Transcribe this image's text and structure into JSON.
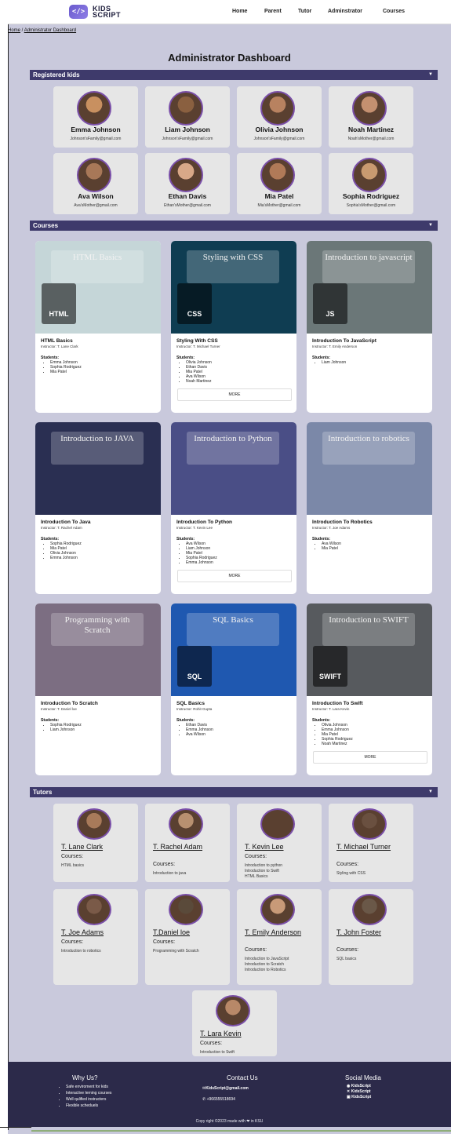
{
  "brand": {
    "line1": "KIDS",
    "line2": "SCRIPT",
    "mark": "</>"
  },
  "nav": [
    "Home",
    "Parent",
    "Tutor",
    "Adminstrator",
    "Courses"
  ],
  "breadcrumb": {
    "home": "Home",
    "sep": " / ",
    "current": "Administrator Dashboard"
  },
  "title": "Administrator Dashboard",
  "sections": {
    "kids": "Registered kids",
    "courses": "Courses",
    "tutors": "Tutors"
  },
  "kids": [
    {
      "name": "Emma Johnson",
      "email": "Johnson'sFamily@gmail.com",
      "avatar_color": "#c89060"
    },
    {
      "name": "Liam Johnson",
      "email": "Johnson'sFamily@gmail.com",
      "avatar_color": "#8a6040"
    },
    {
      "name": "Olivia Johnson",
      "email": "Johnson'sFamily@gmail.com",
      "avatar_color": "#b88260"
    },
    {
      "name": "Noah Martinez",
      "email": "Noah'sMother@gmail.com",
      "avatar_color": "#c49070"
    },
    {
      "name": "Ava Wilson",
      "email": "Ava'sMother@gmail.com",
      "avatar_color": "#a87858"
    },
    {
      "name": "Ethan Davis",
      "email": "Ethan'sMother@gmail.com",
      "avatar_color": "#d8a888"
    },
    {
      "name": "Mia Patel",
      "email": "Mia'sMother@gmail.com",
      "avatar_color": "#b07a58"
    },
    {
      "name": "Sophia Rodriguez",
      "email": "Sophia'sMother@gmail.com",
      "avatar_color": "#c89a70"
    }
  ],
  "students_label": "Students:",
  "more_label": "MORE",
  "courses": [
    {
      "title": "HTML Basics",
      "instructor": "Instructor: T. Lane Clark",
      "img_title": "HTML Basics",
      "badge": "HTML",
      "bg": "#c5d6d8",
      "students": [
        "Emma Johnson",
        "Sophia Rodriguez",
        "Mia Patel"
      ],
      "more": false
    },
    {
      "title": "Styling With CSS",
      "instructor": "Instructor: T. Michael Turner",
      "img_title": "Styling with CSS",
      "badge": "CSS",
      "bg": "#0f3d52",
      "students": [
        "Olivia Johnson",
        "Ethan Davis",
        "Mia Patel",
        "Ava Wilson",
        "Noah Martinez"
      ],
      "more": true
    },
    {
      "title": "Introduction To JavaScript",
      "instructor": "Instructor: T. Emily Anderson",
      "img_title": "Introduction to javascript",
      "badge": "JS",
      "bg": "#6b7778",
      "students": [
        "Liam Johnson"
      ],
      "more": false
    },
    {
      "title": "Introduction To Java",
      "instructor": "Instructor: T. Rachel Adam",
      "img_title": "Introduction to JAVA",
      "badge": "",
      "bg": "#2a2f52",
      "students": [
        "Sophia Rodriguez",
        "Mia Patel",
        "Olivia Johnson",
        "Emma Johnson"
      ],
      "more": false
    },
    {
      "title": "Introduction To Python",
      "instructor": "Instructor: T. Kevin Lee",
      "img_title": "Introduction to Python",
      "badge": "",
      "bg": "#4a4e86",
      "students": [
        "Ava Wilson",
        "Liam Johnson",
        "Mia Patel",
        "Sophia Rodriguez",
        "Emma Johnson"
      ],
      "more": true
    },
    {
      "title": "Introduction To Robotics",
      "instructor": "Instructor: T. Joe Adams",
      "img_title": "Introduction to robotics",
      "badge": "",
      "bg": "#7b88a8",
      "students": [
        "Ava Wilson",
        "Mia Patel"
      ],
      "more": false
    },
    {
      "title": "Introduction To Scratch",
      "instructor": "Instructor: T. Daniel loe",
      "img_title": "Programming with Scratch",
      "badge": "",
      "bg": "#7c6e82",
      "students": [
        "Sophia Rodriguez",
        "Liam Johnson"
      ],
      "more": false
    },
    {
      "title": "SQL Basics",
      "instructor": "Instructor: Rohit Gupta",
      "img_title": "SQL Basics",
      "badge": "SQL",
      "bg": "#1f58b0",
      "students": [
        "Ethan Davis",
        "Emma Johnson",
        "Ava Wilson"
      ],
      "more": false
    },
    {
      "title": "Introduction To Swift",
      "instructor": "Instructor: T. Lara Kevin",
      "img_title": "Introduction to SWIFT",
      "badge": "SWIFT",
      "bg": "#575a5e",
      "students": [
        "Olivia Johnson",
        "Emma Johnson",
        "Mia Patel",
        "Sophia Rodriguez",
        "Noah Martinez"
      ],
      "more": true
    }
  ],
  "courses_label": "Courses:",
  "tutors": [
    {
      "name": "T. Lane Clark",
      "courses": [
        "HTML basics"
      ],
      "avatar_color": "#a87a5a"
    },
    {
      "name": "T. Rachel Adam",
      "courses": [
        "Introduction to java"
      ],
      "avatar_color": "#b89070"
    },
    {
      "name": "T. Kevin Lee",
      "courses": [
        "Introduction to python",
        "Introduction to Swift",
        "HTML Basics"
      ],
      "avatar_color": "#5a4030"
    },
    {
      "name": "T. Michael Turner",
      "courses": [
        "Styling with CSS"
      ],
      "avatar_color": "#6a5040"
    },
    {
      "name": "T. Joe Adams",
      "courses": [
        "Introduction to robotics"
      ],
      "avatar_color": "#7a5a48"
    },
    {
      "name": "T.Daniel loe",
      "courses": [
        "Programming with Scratch"
      ],
      "avatar_color": "#5a4a3a"
    },
    {
      "name": "T. Emily Anderson",
      "courses": [
        "Introduction to JavaScript",
        "Introduction to Scratch",
        "Introduction to Robotics"
      ],
      "avatar_color": "#c89a78"
    },
    {
      "name": "T. John Foster",
      "courses": [
        "SQL basics"
      ],
      "avatar_color": "#6a5848"
    },
    {
      "name": "T. Lara Kevin",
      "courses": [
        "Introduction to Swift"
      ],
      "avatar_color": "#b88868"
    }
  ],
  "footer": {
    "why_title": "Why Us?",
    "why_items": [
      "Safe enviroment for kids",
      "Interactive lerning courses",
      "Well qulified instructers",
      "Flexible scheduels"
    ],
    "contact_title": "Contact Us",
    "email": "KidsScript@gmail.com",
    "phone": "+966555518694",
    "social_title": "Social Media",
    "social": [
      "KidsScript",
      "KidsScript",
      "KidsScript"
    ],
    "copyright": "Copy right ©2023 made with ❤ in KSU"
  },
  "colors": {
    "page_bg": "#c9c9dc",
    "section_bar": "#3e3a6b",
    "footer_bg": "#2c2a4a",
    "avatar_ring": "#7a4fa8"
  }
}
